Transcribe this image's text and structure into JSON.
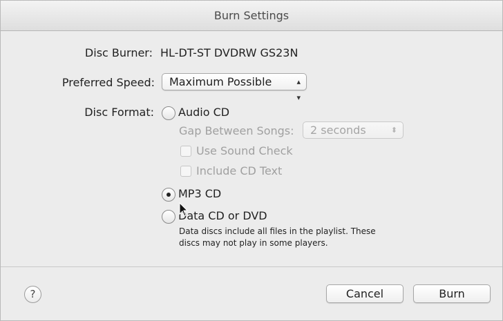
{
  "window": {
    "title": "Burn Settings"
  },
  "disc_burner": {
    "label": "Disc Burner:",
    "value": "HL-DT-ST DVDRW  GS23N"
  },
  "preferred_speed": {
    "label": "Preferred Speed:",
    "value": "Maximum Possible"
  },
  "disc_format": {
    "label": "Disc Format:",
    "selected": "MP3 CD",
    "options": {
      "audio_cd": "Audio CD",
      "mp3_cd": "MP3 CD",
      "data_cd": "Data CD or DVD"
    },
    "gap_label": "Gap Between Songs:",
    "gap_value": "2 seconds",
    "use_sound_check": "Use Sound Check",
    "include_cd_text": "Include CD Text",
    "data_note_line1": "Data discs include all files in the playlist.  These",
    "data_note_line2": "discs may not play in some players."
  },
  "footer": {
    "help_label": "?",
    "cancel_label": "Cancel",
    "burn_label": "Burn"
  }
}
